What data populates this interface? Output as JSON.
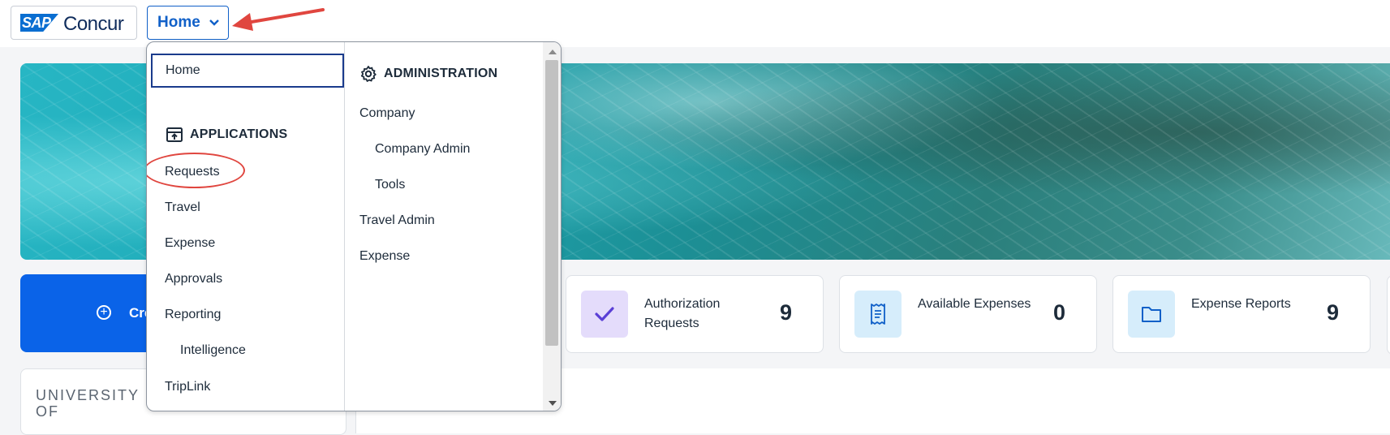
{
  "header": {
    "logo_badge": "SAP",
    "logo_text": "Concur",
    "nav_button": "Home"
  },
  "menu": {
    "home": "Home",
    "applications_heading": "APPLICATIONS",
    "applications": [
      "Requests",
      "Travel",
      "Expense",
      "Approvals",
      "Reporting",
      "Intelligence",
      "TripLink"
    ],
    "administration_heading": "ADMINISTRATION",
    "administration": [
      "Company",
      "Company Admin",
      "Tools",
      "Travel Admin",
      "Expense"
    ]
  },
  "dashboard": {
    "create_label": "Cre",
    "tiles": [
      {
        "label": "Authorization Requests",
        "count": "9",
        "icon": "checkmark-icon",
        "icon_bg": "#e4dcfb",
        "icon_color": "#5a3fd6"
      },
      {
        "label": "Available Expenses",
        "count": "0",
        "icon": "receipt-icon",
        "icon_bg": "#d6edfb",
        "icon_color": "#1060c8"
      },
      {
        "label": "Expense Reports",
        "count": "9",
        "icon": "folder-icon",
        "icon_bg": "#d6edfb",
        "icon_color": "#1060c8"
      }
    ],
    "university_label": "UNIVERSITY OF"
  },
  "colors": {
    "accent": "#1060c8",
    "create_button": "#0a63e8",
    "annotation": "#e0463f"
  }
}
